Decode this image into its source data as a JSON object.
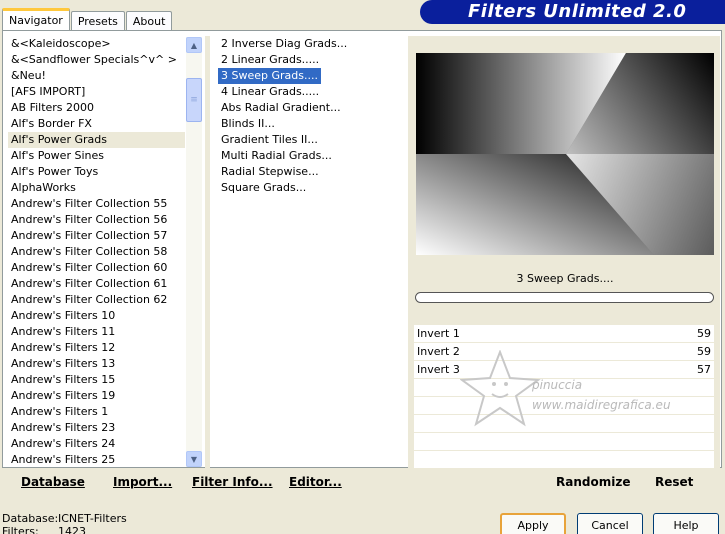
{
  "header": {
    "title": "Filters Unlimited 2.0"
  },
  "tabs": [
    {
      "label": "Navigator",
      "active": true
    },
    {
      "label": "Presets",
      "active": false
    },
    {
      "label": "About",
      "active": false
    }
  ],
  "categories": [
    "&<Kaleidoscope>",
    "&<Sandflower Specials^v^ >",
    "&Neu!",
    "[AFS IMPORT]",
    "AB Filters 2000",
    "Alf's Border FX",
    "Alf's Power Grads",
    "Alf's Power Sines",
    "Alf's Power Toys",
    "AlphaWorks",
    "Andrew's Filter Collection 55",
    "Andrew's Filter Collection 56",
    "Andrew's Filter Collection 57",
    "Andrew's Filter Collection 58",
    "Andrew's Filter Collection 60",
    "Andrew's Filter Collection 61",
    "Andrew's Filter Collection 62",
    "Andrew's Filters 10",
    "Andrew's Filters 11",
    "Andrew's Filters 12",
    "Andrew's Filters 13",
    "Andrew's Filters 15",
    "Andrew's Filters 19",
    "Andrew's Filters 1",
    "Andrew's Filters 23",
    "Andrew's Filters 24",
    "Andrew's Filters 25"
  ],
  "selected_category": "Alf's Power Grads",
  "filters": [
    "2 Inverse Diag Grads...",
    "2 Linear Grads.....",
    "3 Sweep Grads....",
    "4 Linear Grads.....",
    "Abs Radial Gradient...",
    "Blinds II...",
    "Gradient Tiles II...",
    "Multi Radial Grads...",
    "Radial Stepwise...",
    "Square Grads..."
  ],
  "selected_filter": "3 Sweep Grads....",
  "preview": {
    "filter_name": "3 Sweep Grads...."
  },
  "parameters": [
    {
      "label": "Invert 1",
      "value": "59"
    },
    {
      "label": "Invert 2",
      "value": "59"
    },
    {
      "label": "Invert 3",
      "value": "57"
    }
  ],
  "toolbar": {
    "database": "Database",
    "import": "Import...",
    "filter_info": "Filter Info...",
    "editor": "Editor...",
    "randomize": "Randomize",
    "reset": "Reset"
  },
  "footer": {
    "database_label": "Database:",
    "database_value": "ICNET-Filters",
    "filters_label": "Filters:",
    "filters_value": "1423"
  },
  "buttons": {
    "apply": "Apply",
    "cancel": "Cancel",
    "help": "Help"
  },
  "watermark": {
    "line1": "pinuccia",
    "line2": "www.maidiregrafica.eu"
  },
  "colors": {
    "banner": "#0a1f9c",
    "selection": "#316ac5",
    "panel": "#ece9d8"
  }
}
